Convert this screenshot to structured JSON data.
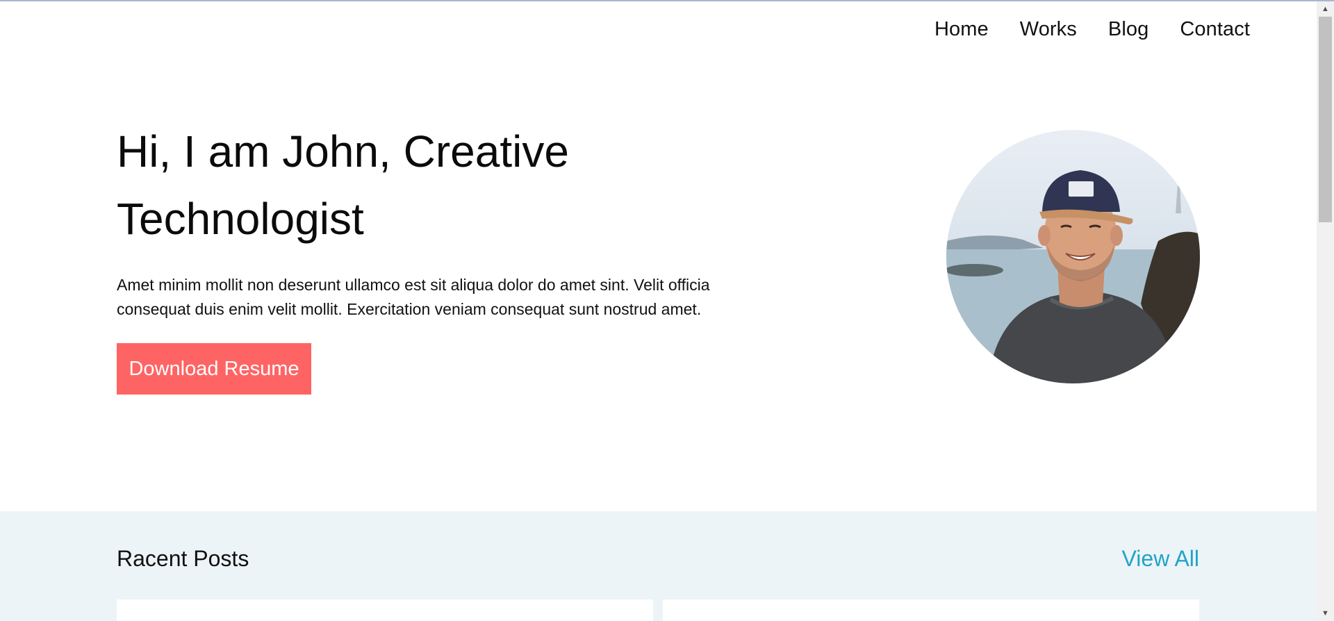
{
  "nav": {
    "items": [
      {
        "label": "Home"
      },
      {
        "label": "Works"
      },
      {
        "label": "Blog"
      },
      {
        "label": "Contact"
      }
    ]
  },
  "hero": {
    "title": "Hi, I am John, Creative Technologist",
    "description": "Amet minim mollit non deserunt ullamco est sit aliqua dolor do amet sint. Velit officia consequat duis enim velit mollit. Exercitation veniam consequat sunt nostrud amet.",
    "cta_label": "Download Resume",
    "avatar_icon": "profile-photo"
  },
  "recent_posts": {
    "title": "Racent Posts",
    "view_all_label": "View All"
  },
  "colors": {
    "accent": "#ff6464",
    "link": "#21a3c9",
    "band_background": "#edf4f7"
  },
  "icons": {
    "scroll_up": "▲",
    "scroll_down": "▼"
  }
}
